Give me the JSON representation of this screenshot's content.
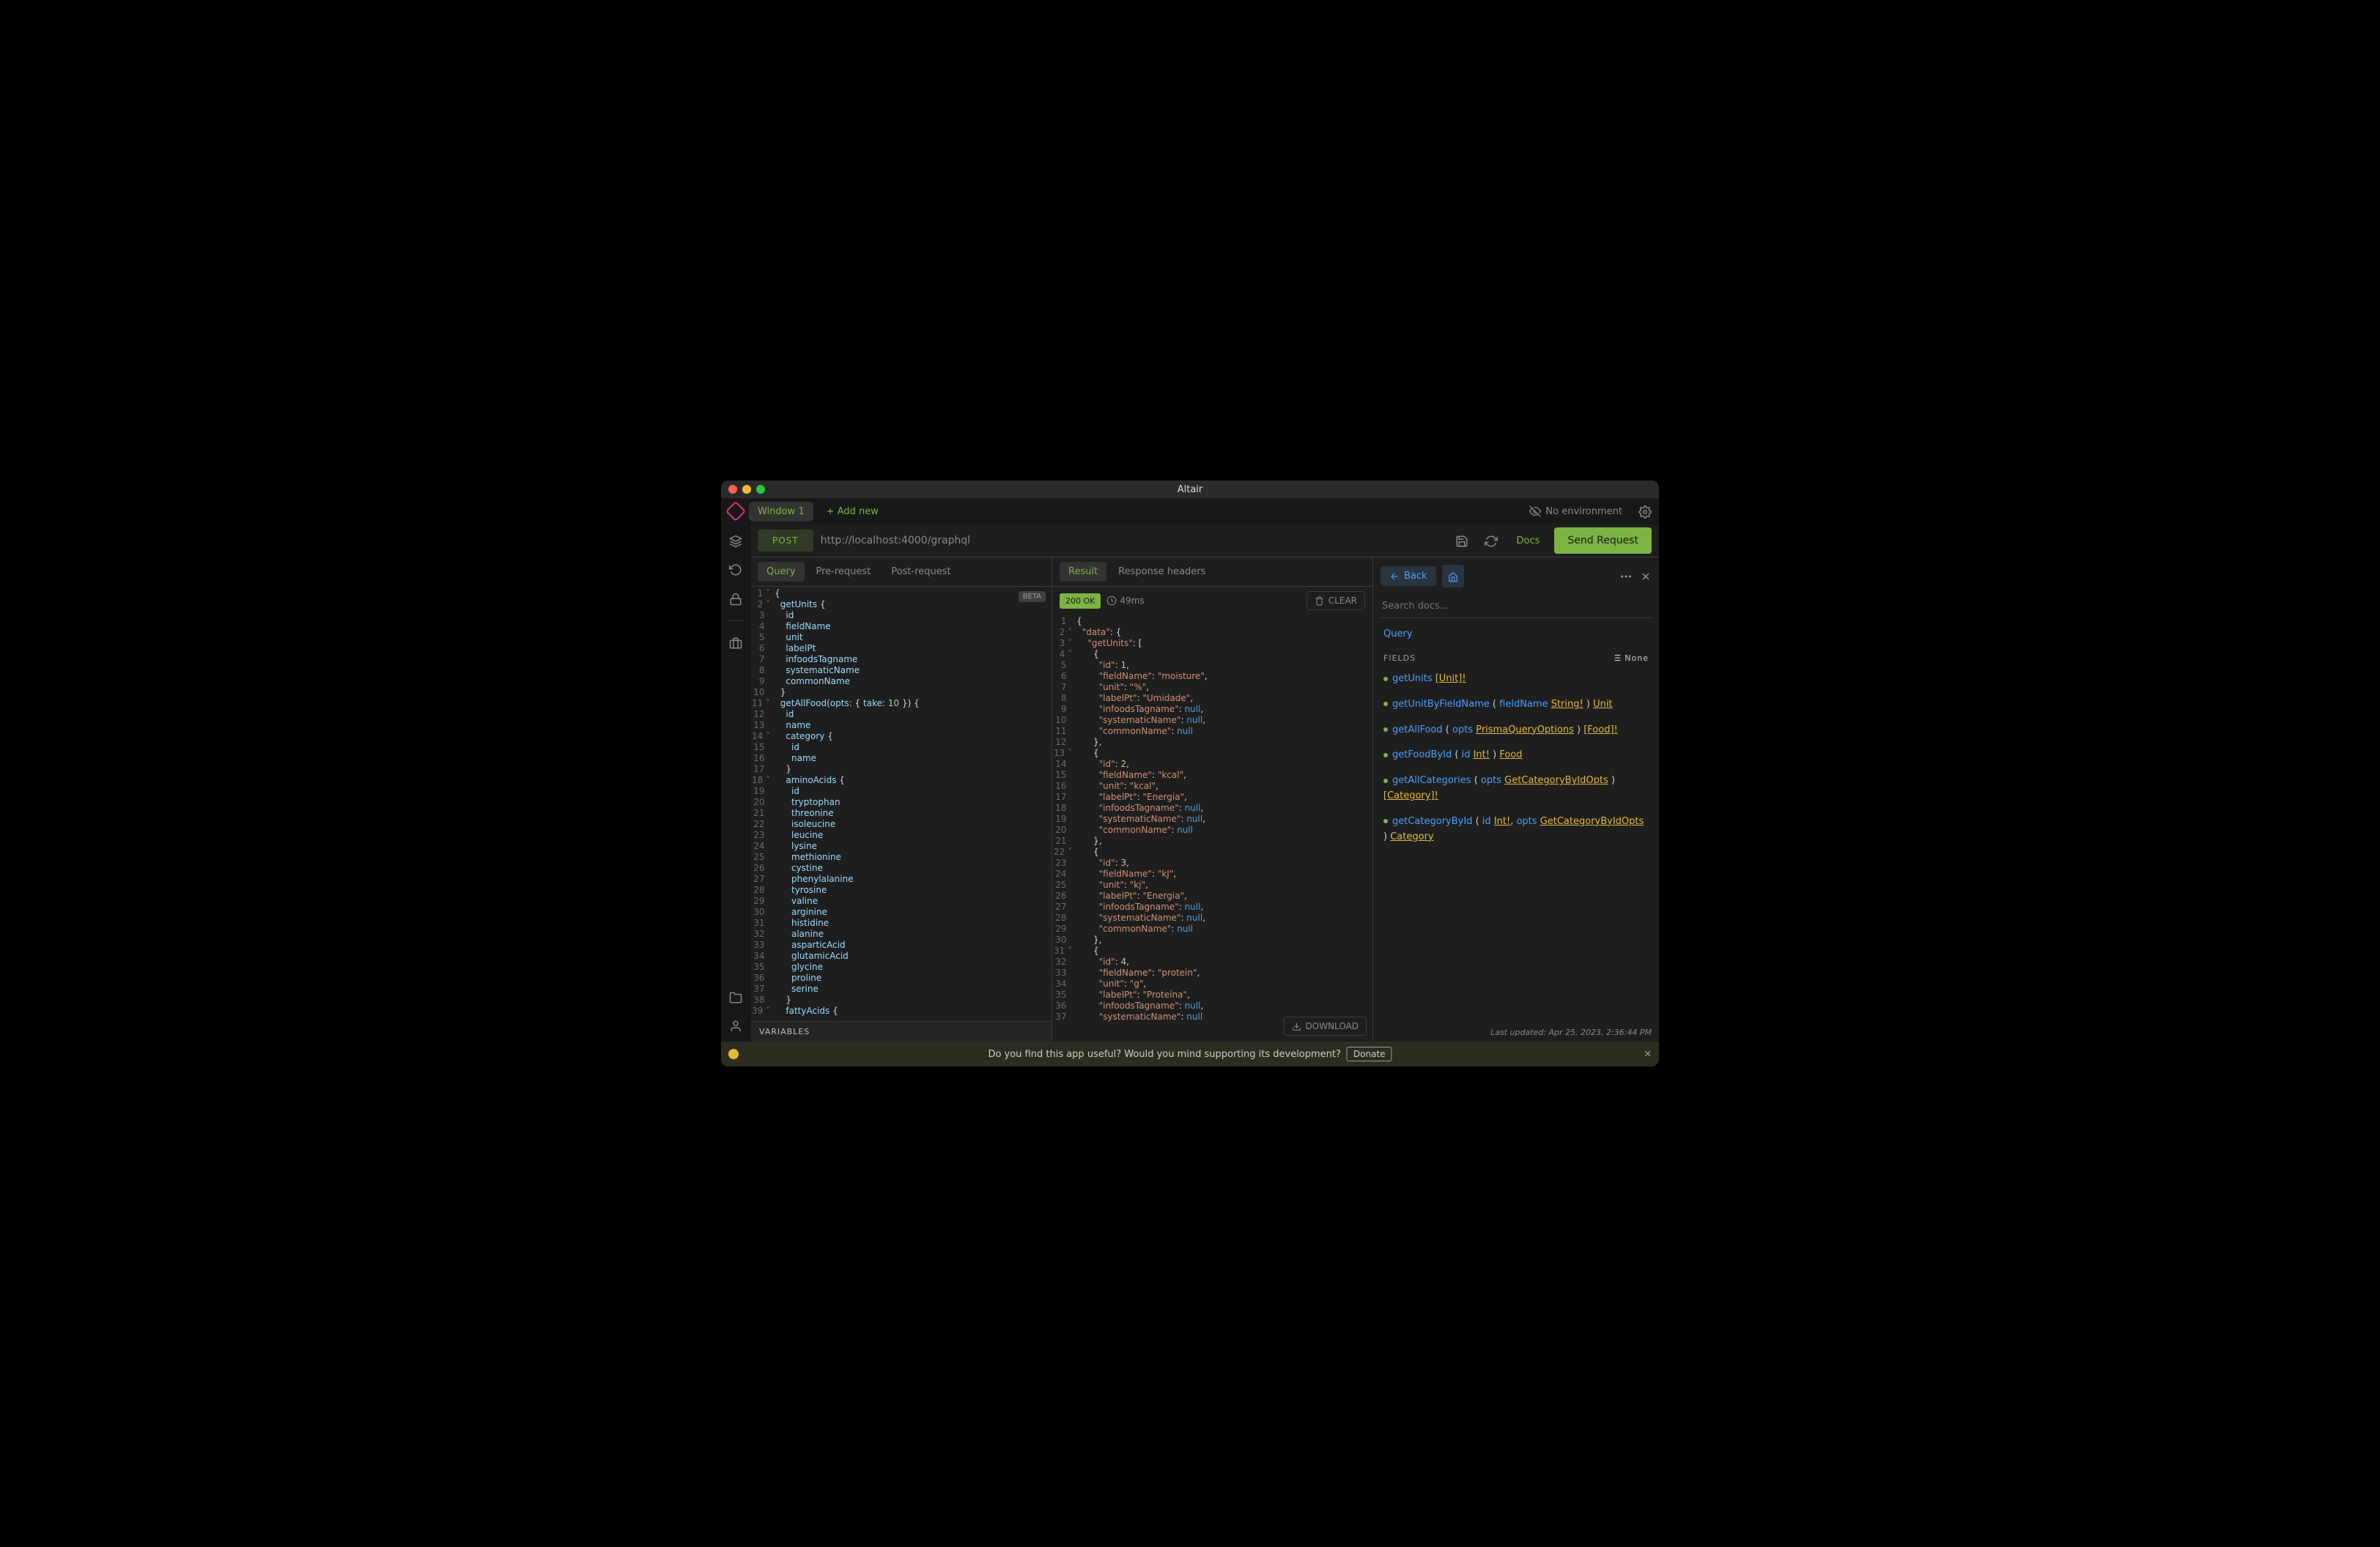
{
  "window": {
    "title": "Altair"
  },
  "tabs": {
    "window1": "Window 1",
    "addnew": "+ Add new"
  },
  "environment": {
    "label": "No environment"
  },
  "urlbar": {
    "method": "POST",
    "url": "http://localhost:4000/graphql",
    "docs": "Docs",
    "send": "Send Request"
  },
  "queryTabs": {
    "query": "Query",
    "prerequest": "Pre-request",
    "postrequest": "Post-request",
    "beta": "BETA"
  },
  "resultTabs": {
    "result": "Result",
    "responseHeaders": "Response headers"
  },
  "status": {
    "code": "200 OK",
    "time": "49ms",
    "clear": "CLEAR",
    "download": "DOWNLOAD"
  },
  "queryCode": [
    "{",
    "  getUnits {",
    "    id",
    "    fieldName",
    "    unit",
    "    labelPt",
    "    infoodsTagname",
    "    systematicName",
    "    commonName",
    "  }",
    "  getAllFood(opts: { take: 10 }) {",
    "    id",
    "    name",
    "    category {",
    "      id",
    "      name",
    "    }",
    "    aminoAcids {",
    "      id",
    "      tryptophan",
    "      threonine",
    "      isoleucine",
    "      leucine",
    "      lysine",
    "      methionine",
    "      cystine",
    "      phenylalanine",
    "      tyrosine",
    "      valine",
    "      arginine",
    "      histidine",
    "      alanine",
    "      asparticAcid",
    "      glutamicAcid",
    "      glycine",
    "      proline",
    "      serine",
    "    }",
    "    fattyAcids {"
  ],
  "variables": "VARIABLES",
  "resultData": {
    "data": {
      "getUnits": [
        {
          "id": 1,
          "fieldName": "moisture",
          "unit": "%",
          "labelPt": "Umidade",
          "infoodsTagname": null,
          "systematicName": null,
          "commonName": null
        },
        {
          "id": 2,
          "fieldName": "kcal",
          "unit": "kcal",
          "labelPt": "Energia",
          "infoodsTagname": null,
          "systematicName": null,
          "commonName": null
        },
        {
          "id": 3,
          "fieldName": "kJ",
          "unit": "kj",
          "labelPt": "Energia",
          "infoodsTagname": null,
          "systematicName": null,
          "commonName": null
        },
        {
          "id": 4,
          "fieldName": "protein",
          "unit": "g",
          "labelPt": "Proteína",
          "infoodsTagname": null,
          "systematicName": null
        }
      ]
    }
  },
  "docs": {
    "back": "Back",
    "searchPlaceholder": "Search docs...",
    "query": "Query",
    "fieldsHeader": "FIELDS",
    "none": "None",
    "fields": [
      {
        "name": "getUnits",
        "return": "[Unit]!"
      },
      {
        "name": "getUnitByFieldName",
        "params": [
          {
            "name": "fieldName",
            "type": "String!"
          }
        ],
        "return": "Unit"
      },
      {
        "name": "getAllFood",
        "params": [
          {
            "name": "opts",
            "type": "PrismaQueryOptions"
          }
        ],
        "return": "[Food]!"
      },
      {
        "name": "getFoodById",
        "params": [
          {
            "name": "id",
            "type": "Int!"
          }
        ],
        "return": "Food"
      },
      {
        "name": "getAllCategories",
        "params": [
          {
            "name": "opts",
            "type": "GetCategoryByIdOpts"
          }
        ],
        "return": "[Category]!"
      },
      {
        "name": "getCategoryById",
        "params": [
          {
            "name": "id",
            "type": "Int!"
          },
          {
            "name": "opts",
            "type": "GetCategoryByIdOpts"
          }
        ],
        "return": "Category"
      }
    ]
  },
  "timestamp": "Last updated: Apr 25, 2023, 2:36:44 PM",
  "footer": {
    "message": "Do you find this app useful? Would you mind supporting its development?",
    "donate": "Donate"
  }
}
